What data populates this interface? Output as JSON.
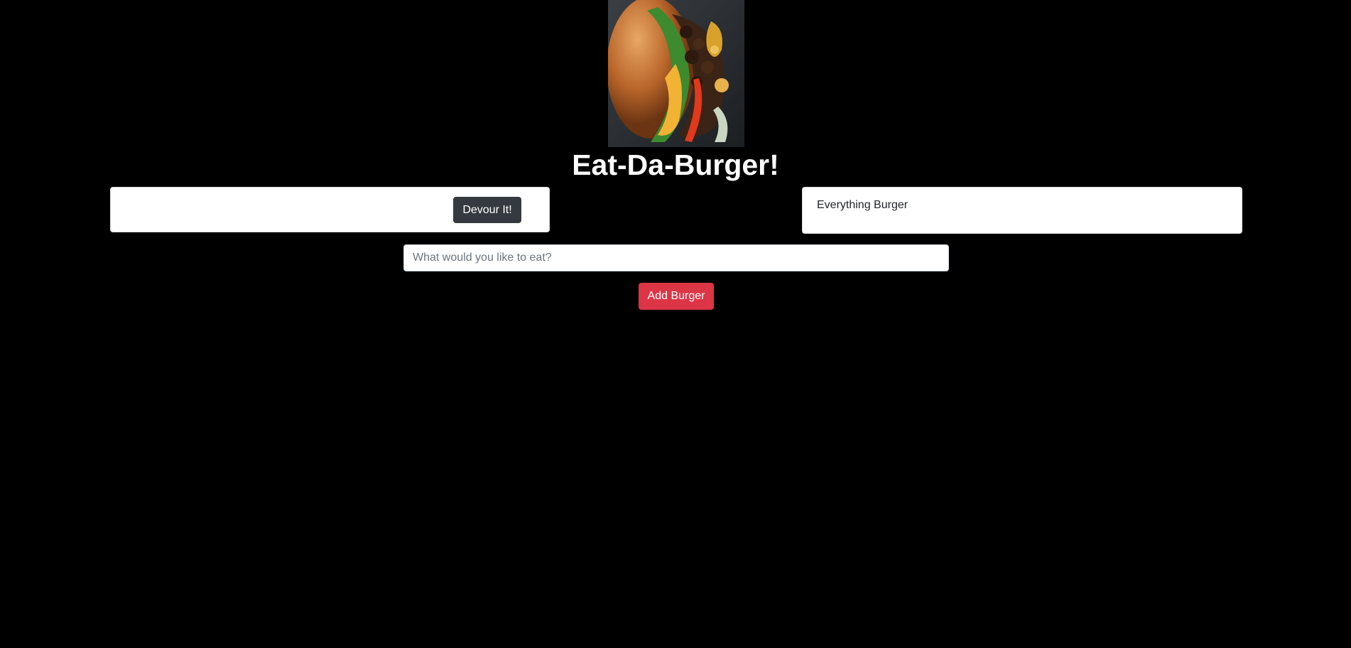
{
  "header": {
    "image_alt": "burger-photo",
    "title": "Eat-Da-Burger!"
  },
  "uneaten": {
    "items": [
      {
        "name": "",
        "devour_label": "Devour It!"
      }
    ]
  },
  "devoured": {
    "items": [
      {
        "name": "Everything Burger"
      }
    ]
  },
  "form": {
    "input_value": "",
    "placeholder": "What would you like to eat?",
    "submit_label": "Add Burger"
  },
  "colors": {
    "background": "#000000",
    "card": "#ffffff",
    "devour_button": "#343a40",
    "add_button": "#dc3545"
  }
}
